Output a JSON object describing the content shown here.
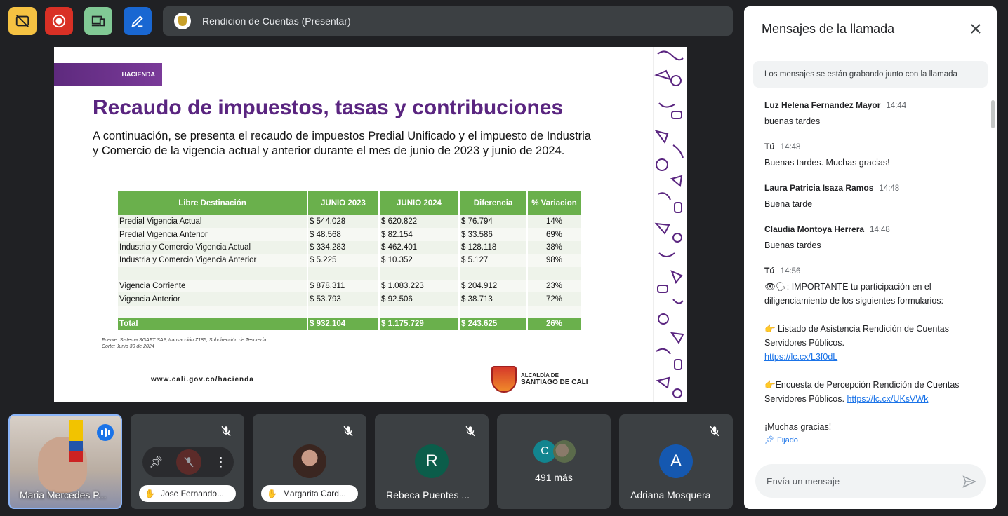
{
  "toolbar": {
    "buttons": [
      {
        "name": "captions-off",
        "color": "#f5c242"
      },
      {
        "name": "record",
        "color": "#ea4335"
      },
      {
        "name": "devices",
        "color": "#81c995"
      },
      {
        "name": "edit",
        "color": "#1a73e8"
      }
    ]
  },
  "presenting": {
    "title": "Rendicion de Cuentas (Presentar)"
  },
  "slide": {
    "band": "HACIENDA",
    "title": "Recaudo de impuestos, tasas y contribuciones",
    "intro": "A continuación, se presenta el recaudo de impuestos Predial Unificado y el impuesto de Industria y Comercio de la vigencia actual y anterior durante el mes de junio de 2023 y junio de 2024.",
    "table": {
      "headers": [
        "Libre Destinación",
        "JUNIO 2023",
        "JUNIO 2024",
        "Diferencia",
        "% Variacion"
      ],
      "rows": [
        [
          "Predial Vigencia Actual",
          "$ 544.028",
          "$ 620.822",
          "$ 76.794",
          "14%"
        ],
        [
          "Predial Vigencia Anterior",
          "$   48.568",
          "$ 82.154",
          "$ 33.586",
          "69%"
        ],
        [
          "Industria y Comercio Vigencia Actual",
          "$ 334.283",
          "$ 462.401",
          "$ 128.118",
          "38%"
        ],
        [
          "Industria y Comercio Vigencia Anterior",
          "$       5.225",
          "$ 10.352",
          "$ 5.127",
          "98%"
        ],
        [
          "",
          "",
          "",
          "",
          ""
        ],
        [
          "Vigencia Corriente",
          "$ 878.311",
          "$ 1.083.223",
          "$ 204.912",
          "23%"
        ],
        [
          "Vigencia Anterior",
          "$ 53.793",
          "$ 92.506",
          "$   38.713",
          "72%"
        ],
        [
          "",
          "",
          "",
          "",
          ""
        ]
      ],
      "total": [
        "Total",
        "$ 932.104",
        "$ 1.175.729",
        "$ 243.625",
        "26%"
      ]
    },
    "source_line1": "Fuente: Sistema SGAFT SAP, transacción Z185, Subdirección de Tesorería",
    "source_line2": "Corte: Junio 30 de 2024",
    "url": "www.cali.gov.co/hacienda",
    "logo_line1": "ALCALDÍA DE",
    "logo_line2": "SANTIAGO DE CALI"
  },
  "participants": {
    "p1": "Maria Mercedes P...",
    "p2": "Jose Fernando...",
    "p3": "Margarita Card...",
    "p4": "Rebeca Puentes ...",
    "p4_initial": "R",
    "p5_initial": "C",
    "p5_more": "491 más",
    "p6": "Adriana Mosquera",
    "p6_initial": "A"
  },
  "chat": {
    "title": "Mensajes de la llamada",
    "notice": "Los mensajes se están grabando junto con la llamada",
    "messages": [
      {
        "sender": "Luz Helena Fernandez Mayor",
        "time": "14:44",
        "text": "buenas tardes"
      },
      {
        "sender": "Tú",
        "time": "14:48",
        "text": "Buenas tardes. Muchas gracias!"
      },
      {
        "sender": "Laura Patricia Isaza Ramos",
        "time": "14:48",
        "text": "Buena tarde"
      },
      {
        "sender": "Claudia Montoya Herrera",
        "time": "14:48",
        "text": "Buenas tardes"
      },
      {
        "sender": "Tú",
        "time": "14:56"
      }
    ],
    "long": {
      "line1": ": IMPORTANTE tu participación en el diligenciamiento de los siguientes formularios:",
      "line2": " Listado de Asistencia Rendición de Cuentas Servidores Públicos.",
      "link1": "https://lc.cx/L3f0dL",
      "line3": "Encuesta de Percepción Rendición de Cuentas Servidores Públicos.",
      "link2": "https://lc.cx/UKsVWk",
      "line4": "¡Muchas gracias!",
      "pinned": "Fijado"
    },
    "input_placeholder": "Envía un mensaje"
  }
}
